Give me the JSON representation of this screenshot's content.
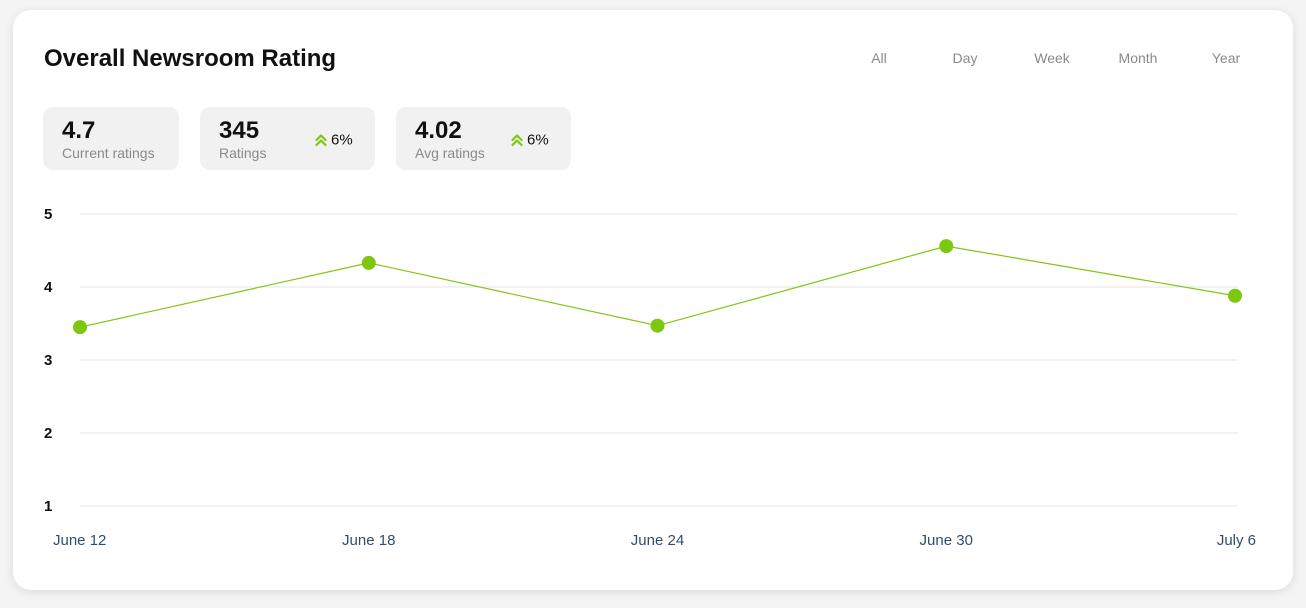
{
  "title": "Overall Newsroom Rating",
  "filters": [
    "All",
    "Day",
    "Week",
    "Month",
    "Year"
  ],
  "stats": [
    {
      "value": "4.7",
      "label": "Current ratings",
      "trend": ""
    },
    {
      "value": "345",
      "label": "Ratings",
      "trend": "6%"
    },
    {
      "value": "4.02",
      "label": "Avg ratings",
      "trend": "6%"
    }
  ],
  "trend_icon": "double-chevron-up-icon",
  "colors": {
    "accent": "#7ec70f",
    "grid": "#e4e4e4",
    "axis_text": "#2f4e6e"
  },
  "chart_data": {
    "type": "line",
    "categories": [
      "June 12",
      "June 18",
      "June 24",
      "June 30",
      "July 6"
    ],
    "series": [
      {
        "values": [
          3.45,
          4.33,
          3.47,
          4.56,
          3.88
        ]
      }
    ],
    "yticks": [
      "5",
      "4",
      "3",
      "2",
      "1"
    ],
    "ylim": [
      1,
      5
    ],
    "grid": true,
    "markers": true
  }
}
